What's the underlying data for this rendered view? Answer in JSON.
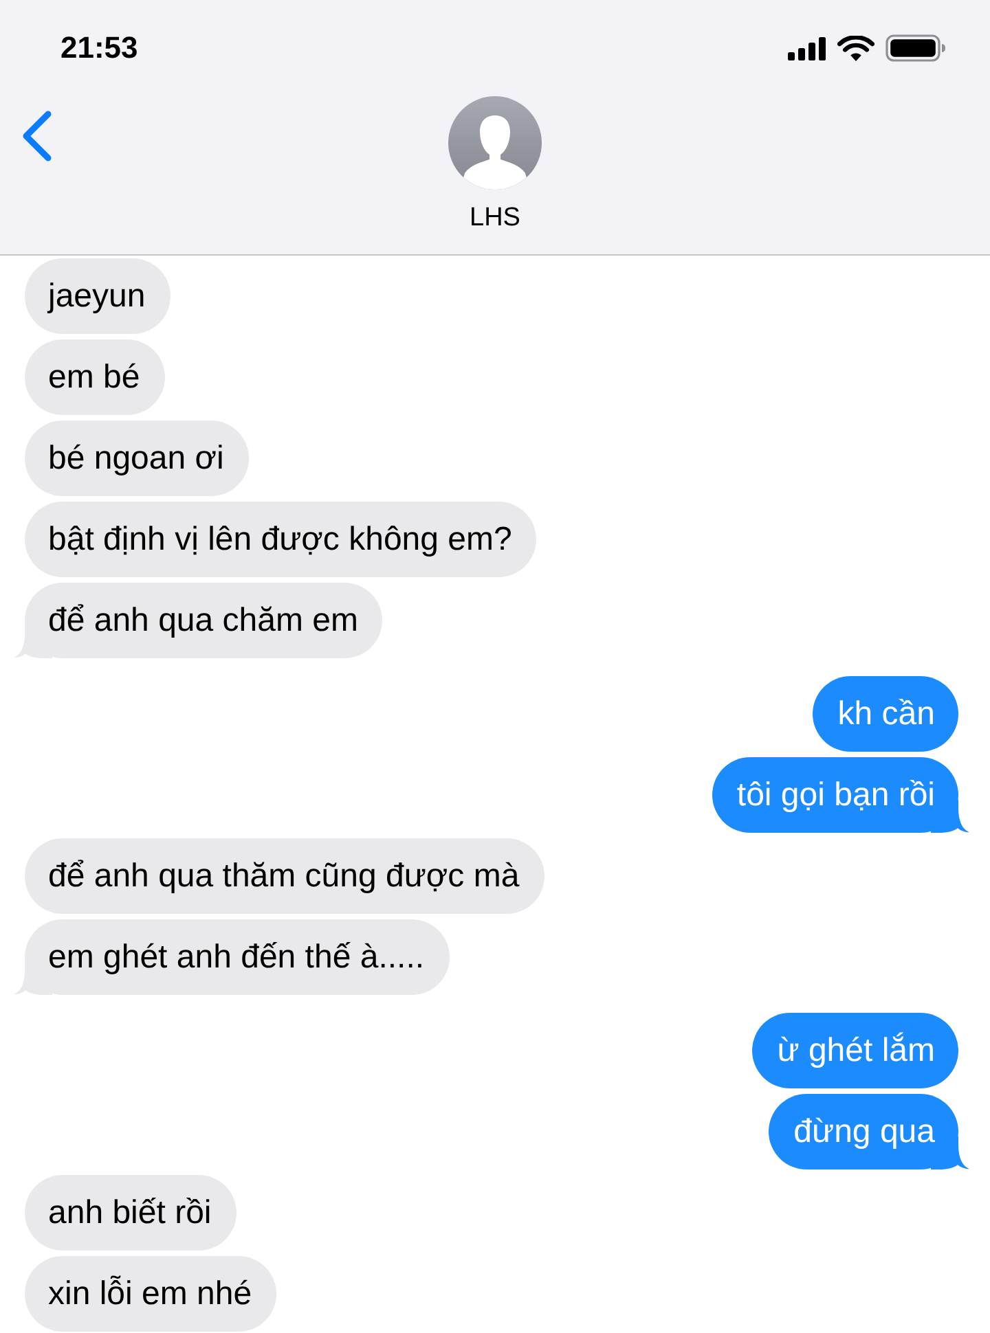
{
  "status_bar": {
    "time": "21:53"
  },
  "header": {
    "contact_name": "LHS"
  },
  "messages": [
    {
      "kind": "received",
      "text": "jaeyun",
      "tail": false
    },
    {
      "kind": "received",
      "text": "em bé",
      "tail": false
    },
    {
      "kind": "received",
      "text": "bé ngoan ơi",
      "tail": false
    },
    {
      "kind": "received",
      "text": "bật định vị lên được không em?",
      "tail": false
    },
    {
      "kind": "received",
      "text": "để anh qua chăm em",
      "tail": true
    },
    {
      "kind": "sent",
      "text": "kh cần",
      "tail": false
    },
    {
      "kind": "sent",
      "text": "tôi gọi bạn rồi",
      "tail": true
    },
    {
      "kind": "received",
      "text": "để anh qua thăm cũng được mà",
      "tail": false
    },
    {
      "kind": "received",
      "text": "em ghét anh đến thế à.....",
      "tail": true
    },
    {
      "kind": "sent",
      "text": "ừ ghét lắm",
      "tail": false
    },
    {
      "kind": "sent",
      "text": "đừng qua",
      "tail": true
    },
    {
      "kind": "received",
      "text": "anh biết rồi",
      "tail": false
    },
    {
      "kind": "received",
      "text": "xin lỗi em nhé",
      "tail": false
    }
  ]
}
